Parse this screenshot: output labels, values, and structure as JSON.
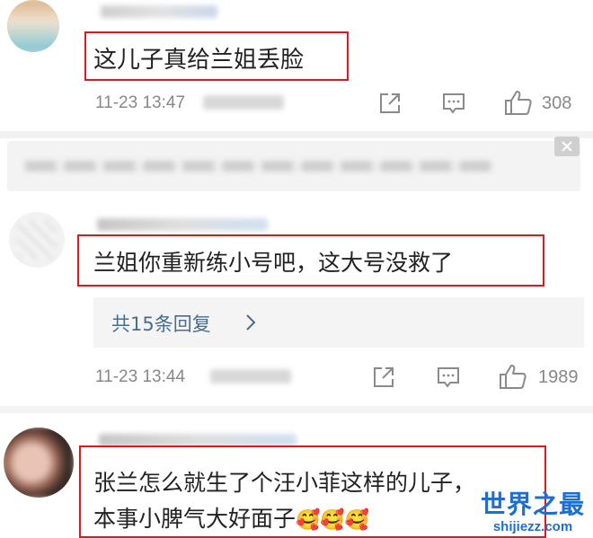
{
  "comments": [
    {
      "text": "这儿子真给兰姐丢脸",
      "time": "11-23 13:47",
      "likes": "308"
    },
    {
      "text": "兰姐你重新练小号吧，这大号没救了",
      "replies_label": "共15条回复",
      "time": "11-23 13:44",
      "likes": "1989"
    },
    {
      "text_line1": "张兰怎么就生了个汪小菲这样的儿子，",
      "text_line2": "本事小脾气大好面子",
      "emojis": [
        "🥰",
        "🥰",
        "🥰"
      ]
    }
  ],
  "watermark": {
    "cn": "世界之最",
    "en": "shijiezz.com"
  },
  "icons": {
    "share": "share-icon",
    "comment": "comment-icon",
    "like": "thumbs-up-icon",
    "close": "close-icon",
    "chevron": "chevron-right-icon"
  }
}
